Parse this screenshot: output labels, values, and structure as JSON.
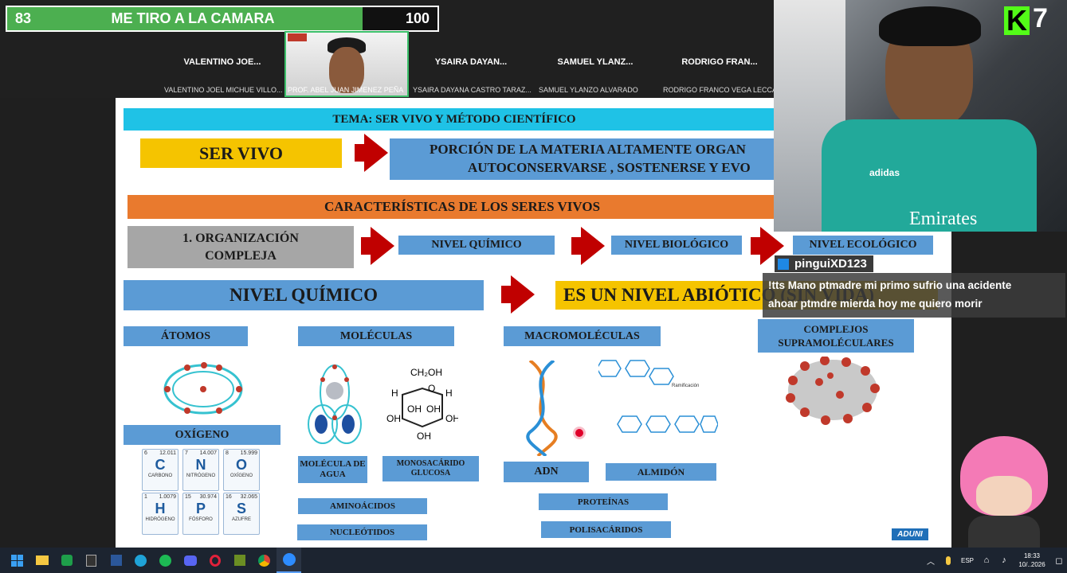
{
  "vote": {
    "left": "83",
    "title": "ME TIRO A LA CAMARA",
    "right": "100"
  },
  "participants": [
    {
      "short": "VALENTINO JOE...",
      "full": "VALENTINO JOEL MICHUE VILLO..."
    },
    {
      "full": "PROF. ABEL JUAN JIMENEZ PEÑA"
    },
    {
      "short": "YSAIRA DAYAN...",
      "full": "YSAIRA DAYANA CASTRO TARAZ..."
    },
    {
      "short": "SAMUEL YLANZ...",
      "full": "SAMUEL YLANZO ALVARADO"
    },
    {
      "short": "RODRIGO FRAN...",
      "full": "RODRIGO FRANCO VEGA LECCA"
    }
  ],
  "slide": {
    "tema": "TEMA: SER VIVO Y MÉTODO CIENTÍFICO",
    "ser_vivo": "SER VIVO",
    "def1": "PORCIÓN DE LA MATERIA ALTAMENTE ORGAN",
    "def2": "AUTOCONSERVARSE , SOSTENERSE Y EVO",
    "caracteristicas": "CARACTERÍSTICAS DE LOS SERES VIVOS",
    "org": "1. ORGANIZACIÓN COMPLEJA",
    "nq": "NIVEL QUÍMICO",
    "nb": "NIVEL BIOLÓGICO",
    "ne": "NIVEL ECOLÓGICO",
    "nq_big": "NIVEL QUÍMICO",
    "abiotico": "ES UN NIVEL ABIÓTICO (SIN VIDA)",
    "atomos": "ÁTOMOS",
    "moleculas": "MOLÉCULAS",
    "macro": "MACROMOLÉCULAS",
    "complejos": "COMPLEJOS SUPRAMOLÉCULARES",
    "oxigeno": "OXÍGENO",
    "agua": "MOLÉCULA DE AGUA",
    "glucosa": "MONOSACÁRIDO GLUCOSA",
    "adn": "ADN",
    "almidon": "ALMIDÓN",
    "aminoacidos": "AMINOÁCIDOS",
    "nucleotidos": "NUCLEÓTIDOS",
    "proteinas": "PROTEÍNAS",
    "polisacaridos": "POLISACÁRIDOS",
    "ch2oh": "CH₂OH",
    "oh": "OH",
    "h": "H",
    "o": "O",
    "ramificacion": "Ramificación",
    "logo": "ADUNI"
  },
  "elements": [
    {
      "num": "6",
      "mass": "12.011",
      "sym": "C",
      "name": "CARBONO"
    },
    {
      "num": "7",
      "mass": "14.007",
      "sym": "N",
      "name": "NITRÓGENO"
    },
    {
      "num": "8",
      "mass": "15.999",
      "sym": "O",
      "name": "OXÍGENO"
    },
    {
      "num": "1",
      "mass": "1.0079",
      "sym": "H",
      "name": "HIDRÓGENO"
    },
    {
      "num": "15",
      "mass": "30.974",
      "sym": "P",
      "name": "FÓSFORO"
    },
    {
      "num": "16",
      "mass": "32.065",
      "sym": "S",
      "name": "AZUFRE"
    }
  ],
  "stream": {
    "badge": "7",
    "chat_user": "pinguiXD123",
    "chat_line1": "!tts Mano ptmadre mi primo sufrio una acidente",
    "chat_line2": "ahoar ptmdre mierda hoy me quiero morir",
    "jersey1": "adidas",
    "jersey2": "Emirates"
  },
  "taskbar": {
    "lang": "ESP",
    "time": "18:33",
    "date": "10/..2026"
  }
}
